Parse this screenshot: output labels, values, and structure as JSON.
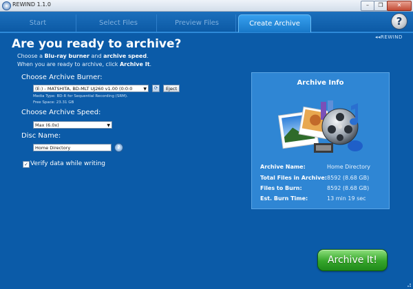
{
  "window": {
    "title": "REWIND 1.1.0",
    "min_label": "–",
    "max_label": "❐",
    "close_label": "✕"
  },
  "tabs": [
    {
      "label": "Start"
    },
    {
      "label": "Select Files"
    },
    {
      "label": "Preview Files"
    },
    {
      "label": "Create Archive"
    }
  ],
  "help_label": "?",
  "brand": "◂◂REWIND",
  "heading": "Are you ready to archive?",
  "intro": {
    "line1_pre": "Choose a ",
    "line1_b1": "Blu-ray burner",
    "line1_mid": " and ",
    "line1_b2": "archive speed",
    "line1_post": ".",
    "line2_pre": "When you are ready to archive, click ",
    "line2_b": "Archive It",
    "line2_post": "."
  },
  "burner": {
    "label": "Choose Archive Burner:",
    "selected": "(E:) - MATSHITA, BD-MLT UJ260       v1.00 (0:0:0",
    "refresh_icon": "⟳",
    "eject_label": "Eject",
    "media_type": "Media Type: BD-R for Sequential Recording (SRM).",
    "free_space": "Free Space: 23.31 GB"
  },
  "speed": {
    "label": "Choose Archive Speed:",
    "selected": "Max (6.0x)"
  },
  "disc": {
    "label": "Disc Name:",
    "value": "Home Directory",
    "help": "?"
  },
  "verify": {
    "checked_mark": "✓",
    "label": "Verify data while writing"
  },
  "info": {
    "title": "Archive Info",
    "rows": [
      {
        "key": "Archive Name:",
        "value": "Home Directory"
      },
      {
        "key": "Total Files in Archive:",
        "value": "8592  (8.68 GB)"
      },
      {
        "key": "Files to Burn:",
        "value": "8592  (8.68 GB)"
      },
      {
        "key": "Est. Burn Time:",
        "value": "13 min 19 sec"
      }
    ]
  },
  "archive_button": "Archive It!",
  "colors": {
    "background": "#0b5ba8",
    "panel": "#2f86d4",
    "archive_button": "#35a52a"
  }
}
